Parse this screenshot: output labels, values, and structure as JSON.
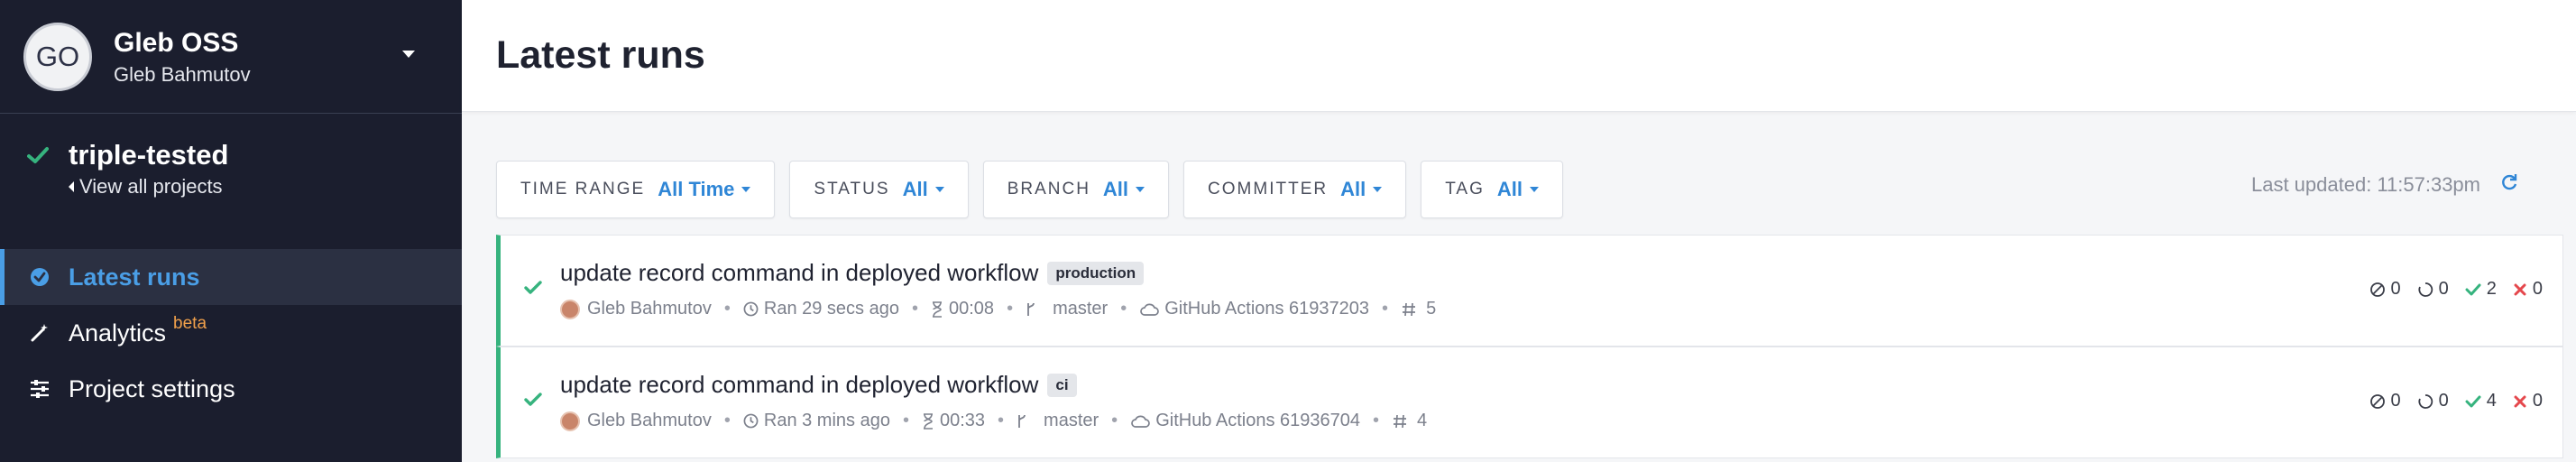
{
  "org": {
    "initials": "GO",
    "name": "Gleb OSS",
    "user": "Gleb Bahmutov"
  },
  "project": {
    "name": "triple-tested",
    "view_all": "View all projects"
  },
  "nav": [
    {
      "label": "Latest runs",
      "icon": "check-circle-icon",
      "active": true
    },
    {
      "label": "Analytics",
      "badge": "beta",
      "icon": "magic-wand-icon"
    },
    {
      "label": "Project settings",
      "icon": "sliders-icon"
    }
  ],
  "page": {
    "title": "Latest runs"
  },
  "filters": [
    {
      "label": "TIME RANGE",
      "value": "All Time"
    },
    {
      "label": "STATUS",
      "value": "All"
    },
    {
      "label": "BRANCH",
      "value": "All"
    },
    {
      "label": "COMMITTER",
      "value": "All"
    },
    {
      "label": "TAG",
      "value": "All"
    }
  ],
  "last_updated": "Last updated: 11:57:33pm",
  "runs": [
    {
      "title": "update record command in deployed workflow",
      "tag": "production",
      "author": "Gleb Bahmutov",
      "ran": "Ran 29 secs ago",
      "duration": "00:08",
      "branch": "master",
      "ci": "GitHub Actions 61937203",
      "number": "5",
      "skipped": "0",
      "pending": "0",
      "passed": "2",
      "failed": "0"
    },
    {
      "title": "update record command in deployed workflow",
      "tag": "ci",
      "author": "Gleb Bahmutov",
      "ran": "Ran 3 mins ago",
      "duration": "00:33",
      "branch": "master",
      "ci": "GitHub Actions 61936704",
      "number": "4",
      "skipped": "0",
      "pending": "0",
      "passed": "4",
      "failed": "0"
    }
  ],
  "colors": {
    "sidebar_bg": "#1b1e2e",
    "accent": "#4a9ee6",
    "success": "#36b37e",
    "fail": "#e5484d",
    "beta": "#f0a04b"
  }
}
